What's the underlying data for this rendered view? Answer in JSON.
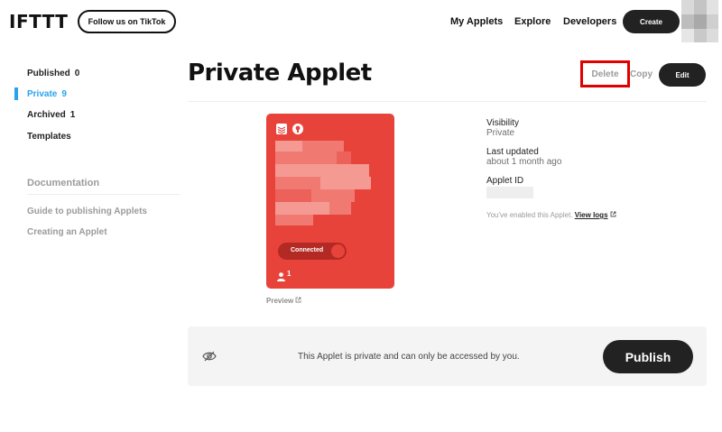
{
  "header": {
    "logo": "IFTTT",
    "tiktok_button": "Follow us on TikTok",
    "nav": [
      "My Applets",
      "Explore",
      "Developers"
    ],
    "create_button": "Create"
  },
  "sidebar": {
    "items": [
      {
        "label": "Published",
        "count": "0"
      },
      {
        "label": "Private",
        "count": "9"
      },
      {
        "label": "Archived",
        "count": "1"
      },
      {
        "label": "Templates",
        "count": ""
      }
    ],
    "active_item": "Private",
    "documentation": {
      "title": "Documentation",
      "links": [
        "Guide to publishing Applets",
        "Creating an Applet"
      ]
    }
  },
  "main": {
    "title": "Private Applet",
    "actions": {
      "delete": "Delete",
      "copy": "Copy",
      "edit": "Edit"
    },
    "card": {
      "toggle_label": "Connected",
      "users_count": "1",
      "service_icons": [
        "todoist-icon",
        "github-icon"
      ],
      "color": "#e8433b"
    },
    "preview_link": "Preview",
    "info": {
      "visibility_label": "Visibility",
      "visibility_value": "Private",
      "updated_label": "Last updated",
      "updated_value": "about 1 month ago",
      "id_label": "Applet ID",
      "enabled_text": "You've enabled this Applet.",
      "view_logs": "View logs"
    },
    "publish_bar": {
      "message": "This Applet is private and can only be accessed by you.",
      "publish_button": "Publish"
    }
  },
  "colors": {
    "accent": "#2aa2ef",
    "highlight": "#e00000",
    "dark": "#222222"
  }
}
